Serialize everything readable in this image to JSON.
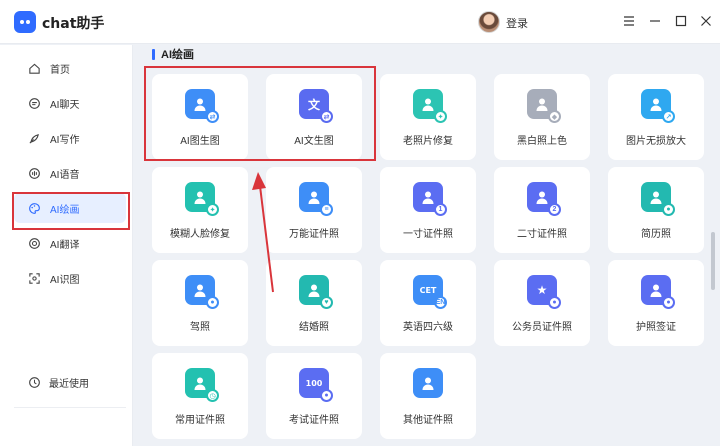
{
  "window": {
    "title": "chat助手",
    "login_label": "登录"
  },
  "sidebar": {
    "items": [
      {
        "label": "首页",
        "icon": "home-icon",
        "active": false
      },
      {
        "label": "AI聊天",
        "icon": "chat-icon",
        "active": false
      },
      {
        "label": "AI写作",
        "icon": "pen-icon",
        "active": false
      },
      {
        "label": "AI语音",
        "icon": "voice-icon",
        "active": false
      },
      {
        "label": "AI绘画",
        "icon": "palette-icon",
        "active": true
      },
      {
        "label": "AI翻译",
        "icon": "translate-icon",
        "active": false
      },
      {
        "label": "AI识图",
        "icon": "scan-icon",
        "active": false
      }
    ],
    "recent_label": "最近使用"
  },
  "main": {
    "section_title": "AI绘画",
    "tools": [
      {
        "label": "AI图生图",
        "icon": "image-to-image-icon",
        "color": "#3e8ef7",
        "glyph": "",
        "badge": "⇄"
      },
      {
        "label": "AI文生图",
        "icon": "text-to-image-icon",
        "color": "#5a6bf0",
        "glyph": "文",
        "badge": "⇄"
      },
      {
        "label": "老照片修复",
        "icon": "old-photo-repair-icon",
        "color": "#2cc4b3",
        "glyph": "",
        "badge": "✦"
      },
      {
        "label": "黑白照上色",
        "icon": "colorize-icon",
        "color": "#a7adba",
        "glyph": "",
        "badge": "◆"
      },
      {
        "label": "图片无损放大",
        "icon": "upscale-icon",
        "color": "#2fa8f0",
        "glyph": "",
        "badge": "↗"
      },
      {
        "label": "模糊人脸修复",
        "icon": "face-repair-icon",
        "color": "#23c1b0",
        "glyph": "",
        "badge": "✦"
      },
      {
        "label": "万能证件照",
        "icon": "id-photo-icon",
        "color": "#3e8ef7",
        "glyph": "",
        "badge": "≡"
      },
      {
        "label": "一寸证件照",
        "icon": "one-inch-photo-icon",
        "color": "#5b6df2",
        "glyph": "",
        "badge": "1"
      },
      {
        "label": "二寸证件照",
        "icon": "two-inch-photo-icon",
        "color": "#5b6df2",
        "glyph": "",
        "badge": "2"
      },
      {
        "label": "简历照",
        "icon": "resume-photo-icon",
        "color": "#23b9b0",
        "glyph": "",
        "badge": "●"
      },
      {
        "label": "驾照",
        "icon": "driver-license-icon",
        "color": "#3e8ef7",
        "glyph": "",
        "badge": "●"
      },
      {
        "label": "结婚照",
        "icon": "wedding-photo-icon",
        "color": "#23b9b0",
        "glyph": "",
        "badge": "♥"
      },
      {
        "label": "英语四六级",
        "icon": "cet-photo-icon",
        "color": "#3e8ef7",
        "glyph": "CET",
        "badge": "EN"
      },
      {
        "label": "公务员证件照",
        "icon": "civil-servant-photo-icon",
        "color": "#5b6df2",
        "glyph": "★",
        "badge": "●"
      },
      {
        "label": "护照签证",
        "icon": "passport-visa-icon",
        "color": "#5b6df2",
        "glyph": "",
        "badge": "●"
      },
      {
        "label": "常用证件照",
        "icon": "common-id-photo-icon",
        "color": "#23c1b0",
        "glyph": "",
        "badge": "◷"
      },
      {
        "label": "考试证件照",
        "icon": "exam-photo-icon",
        "color": "#5b6df2",
        "glyph": "100",
        "badge": "●"
      },
      {
        "label": "其他证件照",
        "icon": "other-id-photo-icon",
        "color": "#3e8ef7",
        "glyph": "",
        "badge": ""
      }
    ]
  },
  "colors": {
    "accent": "#2f6bff",
    "annotation_red": "#d9353b"
  }
}
